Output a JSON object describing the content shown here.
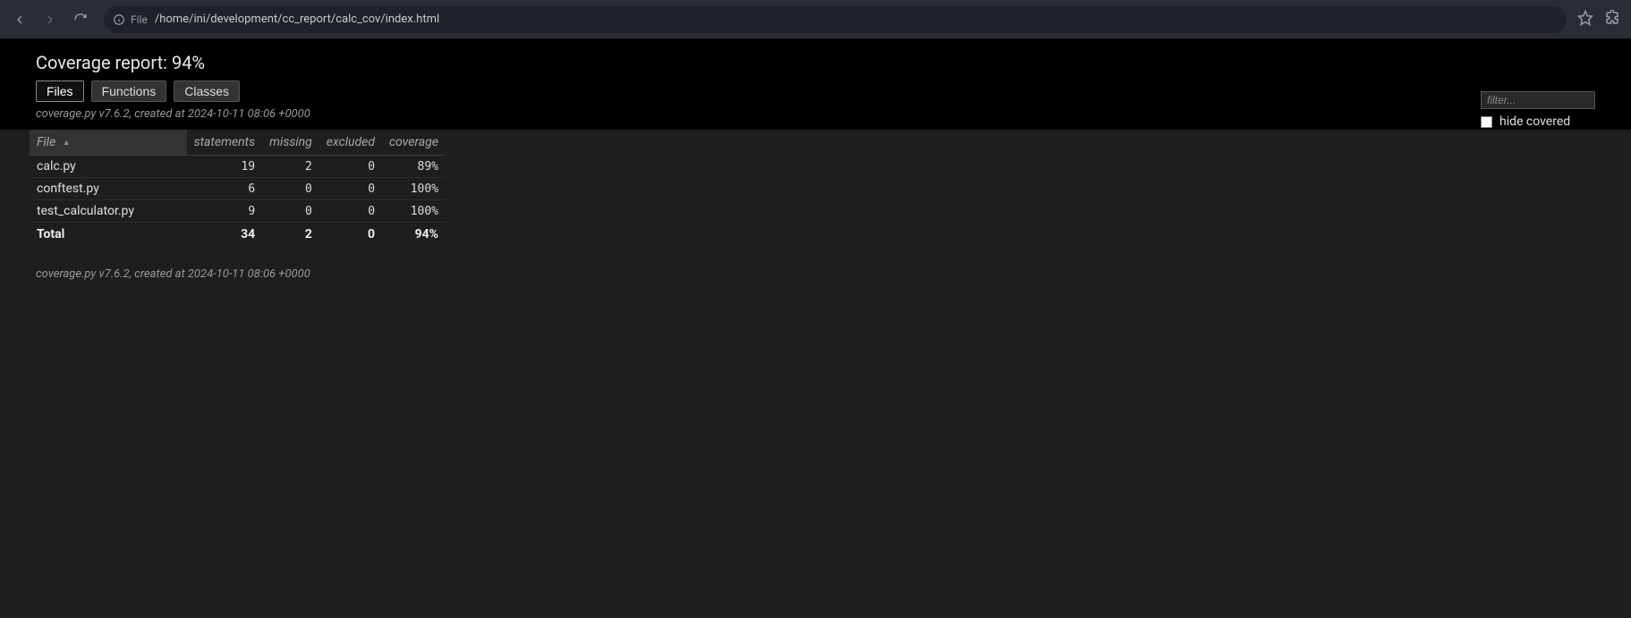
{
  "browser": {
    "scheme_label": "File",
    "url": "/home/ini/development/cc_report/calc_cov/index.html"
  },
  "header": {
    "title": "Coverage report: 94%",
    "tabs": {
      "files": "Files",
      "functions": "Functions",
      "classes": "Classes"
    },
    "meta": "coverage.py v7.6.2, created at 2024-10-11 08:06 +0000"
  },
  "controls": {
    "filter_placeholder": "filter...",
    "hide_covered_label": "hide covered"
  },
  "table": {
    "headers": {
      "file": "File",
      "statements": "statements",
      "missing": "missing",
      "excluded": "excluded",
      "coverage": "coverage"
    },
    "rows": [
      {
        "file": "calc.py",
        "statements": "19",
        "missing": "2",
        "excluded": "0",
        "coverage": "89%"
      },
      {
        "file": "conftest.py",
        "statements": "6",
        "missing": "0",
        "excluded": "0",
        "coverage": "100%"
      },
      {
        "file": "test_calculator.py",
        "statements": "9",
        "missing": "0",
        "excluded": "0",
        "coverage": "100%"
      }
    ],
    "total": {
      "label": "Total",
      "statements": "34",
      "missing": "2",
      "excluded": "0",
      "coverage": "94%"
    }
  },
  "footer": {
    "meta": "coverage.py v7.6.2, created at 2024-10-11 08:06 +0000"
  }
}
